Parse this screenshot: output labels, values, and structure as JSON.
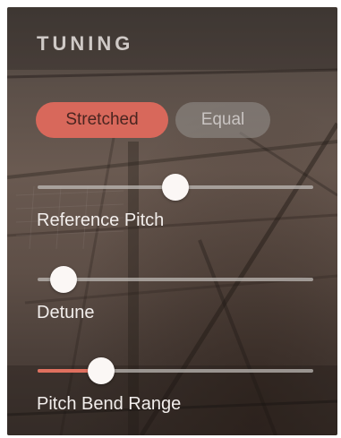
{
  "panel": {
    "title": "TUNING",
    "colors": {
      "accent": "#d8685b",
      "thumb": "#fbf7f5",
      "text": "#f2eeec"
    }
  },
  "tuning_mode": {
    "options": [
      "Stretched",
      "Equal"
    ],
    "selected": "Stretched"
  },
  "sliders": [
    {
      "label": "Reference Pitch",
      "value": 0.5
    },
    {
      "label": "Detune",
      "value": 0.05
    },
    {
      "label": "Pitch Bend Range",
      "value": 0.2
    }
  ]
}
